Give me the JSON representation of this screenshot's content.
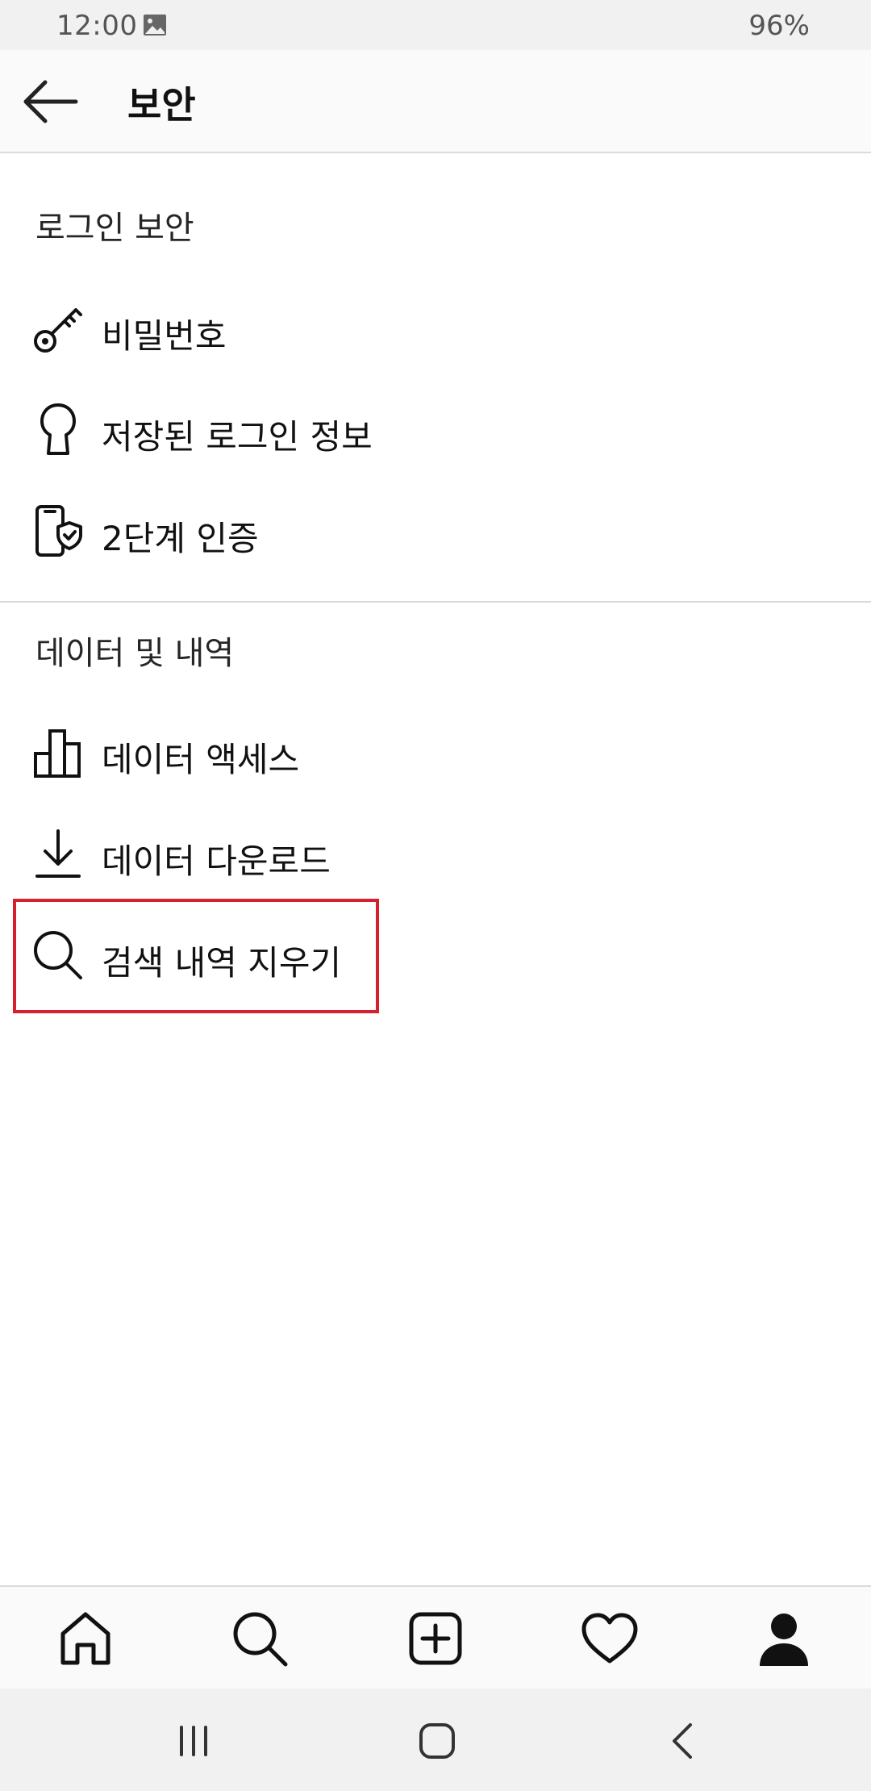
{
  "status_bar": {
    "time": "12:00",
    "battery": "96%",
    "gallery_icon": "image-icon"
  },
  "app_bar": {
    "back_icon": "arrow-left-icon",
    "title": "보안"
  },
  "sections": [
    {
      "header": "로그인 보안",
      "items": [
        {
          "label": "비밀번호",
          "icon": "key-icon"
        },
        {
          "label": "저장된 로그인 정보",
          "icon": "keyhole-icon"
        },
        {
          "label": "2단계 인증",
          "icon": "phone-shield-icon"
        }
      ]
    },
    {
      "header": "데이터 및 내역",
      "items": [
        {
          "label": "데이터 액세스",
          "icon": "bar-chart-icon"
        },
        {
          "label": "데이터 다운로드",
          "icon": "download-icon"
        },
        {
          "label": "검색 내역 지우기",
          "icon": "search-icon",
          "highlighted": true
        }
      ]
    }
  ],
  "highlight_color": "#d6202e",
  "tab_bar": [
    {
      "name": "home",
      "icon": "home-icon"
    },
    {
      "name": "search",
      "icon": "search-icon"
    },
    {
      "name": "new-post",
      "icon": "plus-square-icon"
    },
    {
      "name": "activity",
      "icon": "heart-icon"
    },
    {
      "name": "profile",
      "icon": "person-icon"
    }
  ],
  "system_nav": [
    {
      "name": "recents",
      "icon": "recents-icon"
    },
    {
      "name": "home",
      "icon": "home-square-icon"
    },
    {
      "name": "back",
      "icon": "chevron-left-icon"
    }
  ]
}
